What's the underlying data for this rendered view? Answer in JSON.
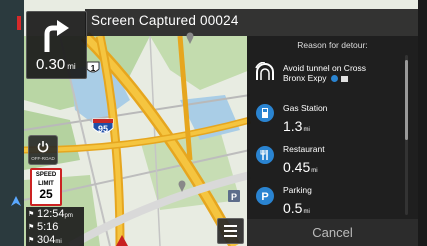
{
  "header": {
    "title": "Screen Captured 00024"
  },
  "maneuver": {
    "distance_value": "0.30",
    "distance_unit": "mi"
  },
  "map": {
    "route_shield": "1",
    "interstate_shield": "95"
  },
  "power_button": {
    "label": "OFF-ROAD"
  },
  "speed_limit": {
    "line1": "SPEED",
    "line2": "LIMIT",
    "value": "25"
  },
  "trip_info": {
    "arrival_time": "12:54",
    "arrival_suffix": "pm",
    "remaining_time": "5:16",
    "remaining_distance": "304",
    "remaining_distance_unit": "mi"
  },
  "detour_panel": {
    "header": "Reason for detour:",
    "items": [
      {
        "icon": "tunnel-icon",
        "line1": "Avoid tunnel on Cross",
        "line2": "Bronx Expy"
      },
      {
        "icon": "gas-station-icon",
        "name": "Gas Station",
        "distance": "1.3",
        "unit": "mi"
      },
      {
        "icon": "restaurant-icon",
        "name": "Restaurant",
        "distance": "0.45",
        "unit": "mi"
      },
      {
        "icon": "parking-icon",
        "name": "Parking",
        "distance": "0.5",
        "unit": "mi"
      }
    ],
    "cancel_label": "Cancel"
  },
  "colors": {
    "accent_blue": "#2a84d1",
    "route_yellow": "#f0b52a",
    "speed_red": "#cc2222"
  }
}
